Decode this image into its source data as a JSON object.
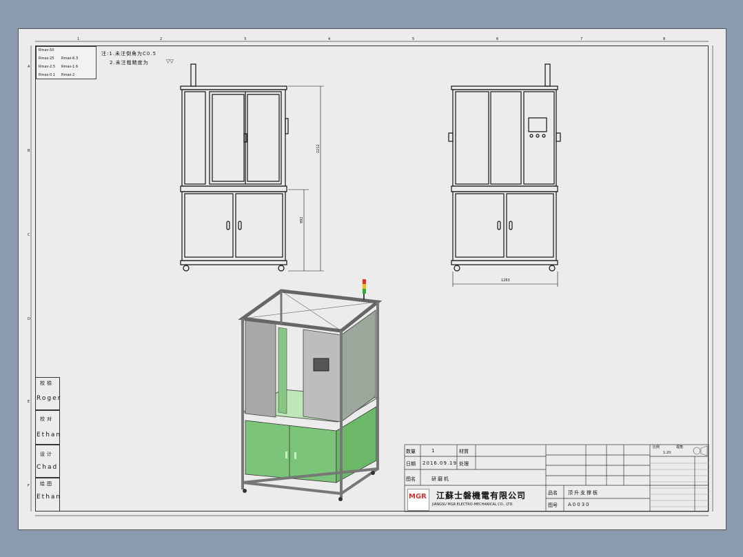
{
  "notes": {
    "line1": "注:1.未注倒角为C0.5",
    "line2": "2.未注粗糙度为"
  },
  "roughness": [
    "Rmax-50",
    "Rmax-25",
    "Rmax-6.3",
    "Rmax-2.5",
    "Rmax-1.6",
    "Rmax-0.1",
    "Rmax-2"
  ],
  "dimensions": {
    "height_total": "2212",
    "height_lower": "992",
    "width": "1263"
  },
  "border_numbers": [
    "1",
    "2",
    "3",
    "4",
    "5",
    "6",
    "7",
    "8"
  ],
  "border_letters": [
    "A",
    "B",
    "C",
    "D",
    "E",
    "F"
  ],
  "signatures": [
    {
      "role": "校檢",
      "name": "Roger"
    },
    {
      "role": "校对",
      "name": "Ethan"
    },
    {
      "role": "设计",
      "name": "Chad"
    },
    {
      "role": "绘图",
      "name": "Ethan"
    }
  ],
  "title_block": {
    "qty_label": "数量",
    "qty_value": "1",
    "material_label": "材質",
    "date_label": "日期",
    "date_value": "2016.09.19",
    "process_label": "处理",
    "drawing_label": "图名",
    "drawing_value": "研磨机",
    "company_cn": "江蘇士磐機電有限公司",
    "company_en": "JIANGSU MGR ELECTRO-MECHANICAL CO., LTD.",
    "logo_text": "MGR",
    "part_label": "品名",
    "part_value": "顶升支撑板",
    "number_label": "图号",
    "number_value": "A0030",
    "scale_label": "比例",
    "scale_value": "1:20",
    "view_label": "视角"
  }
}
